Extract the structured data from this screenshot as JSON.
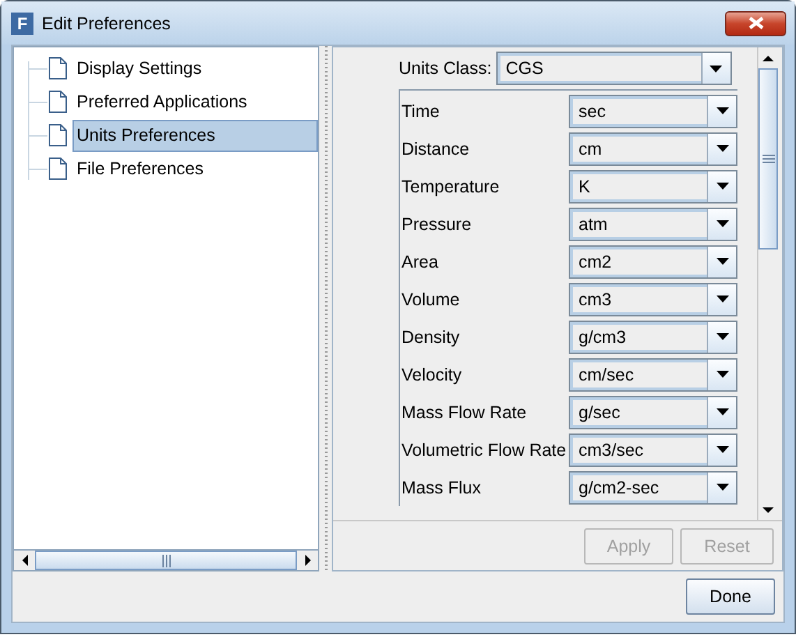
{
  "window": {
    "title": "Edit Preferences",
    "icon_letter": "F"
  },
  "tree": [
    {
      "label": "Display Settings",
      "selected": false
    },
    {
      "label": "Preferred Applications",
      "selected": false
    },
    {
      "label": "Units Preferences",
      "selected": true
    },
    {
      "label": "File Preferences",
      "selected": false
    }
  ],
  "units_class": {
    "label": "Units Class:",
    "value": "CGS"
  },
  "units": [
    {
      "label": "Time",
      "value": "sec"
    },
    {
      "label": "Distance",
      "value": "cm"
    },
    {
      "label": "Temperature",
      "value": "K"
    },
    {
      "label": "Pressure",
      "value": "atm"
    },
    {
      "label": "Area",
      "value": "cm2"
    },
    {
      "label": "Volume",
      "value": "cm3"
    },
    {
      "label": "Density",
      "value": "g/cm3"
    },
    {
      "label": "Velocity",
      "value": "cm/sec"
    },
    {
      "label": "Mass Flow Rate",
      "value": "g/sec"
    },
    {
      "label": "Volumetric Flow Rate",
      "value": "cm3/sec"
    },
    {
      "label": "Mass Flux",
      "value": "g/cm2-sec"
    }
  ],
  "panel_buttons": [
    {
      "label": "Apply",
      "disabled": true
    },
    {
      "label": "Reset",
      "disabled": true
    }
  ],
  "done_button": {
    "label": "Done",
    "disabled": false
  }
}
